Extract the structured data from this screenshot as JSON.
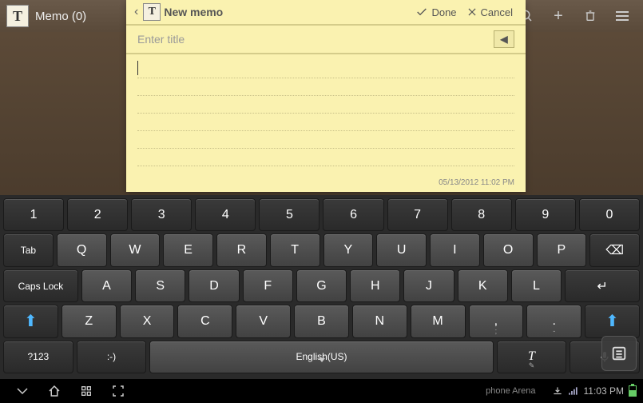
{
  "topbar": {
    "app_icon_glyph": "T",
    "title": "Memo (0)",
    "actions": {
      "add": "+",
      "delete": "🗑",
      "menu": "≡"
    }
  },
  "memo": {
    "icon_glyph": "T",
    "header_label": "New memo",
    "done_label": "Done",
    "cancel_label": "Cancel",
    "title_placeholder": "Enter title",
    "title_value": "",
    "body_value": "",
    "timestamp": "05/13/2012 11:02 PM"
  },
  "keyboard": {
    "row1": [
      "1",
      "2",
      "3",
      "4",
      "5",
      "6",
      "7",
      "8",
      "9",
      "0"
    ],
    "tab_label": "Tab",
    "row2": [
      "Q",
      "W",
      "E",
      "R",
      "T",
      "Y",
      "U",
      "I",
      "O",
      "P"
    ],
    "backspace_glyph": "⌫",
    "caps_label": "Caps Lock",
    "row3": [
      "A",
      "S",
      "D",
      "F",
      "G",
      "H",
      "J",
      "K",
      "L"
    ],
    "enter_glyph": "↵",
    "row4": [
      "Z",
      "X",
      "C",
      "V",
      "B",
      "N",
      "M",
      ",",
      "."
    ],
    "sym_label": "?123",
    "emoji_label": ":-)",
    "space_label": "English(US)",
    "tinput_glyph": "T",
    "mic_glyph": "🎤"
  },
  "floatbtn": {
    "glyph": "≡"
  },
  "navbar": {
    "back_glyph": "◁",
    "home_glyph": "△",
    "recent_glyph": "�裡",
    "brand": "phone Arena",
    "signal_glyph": "📶",
    "time": "11:03 PM"
  }
}
